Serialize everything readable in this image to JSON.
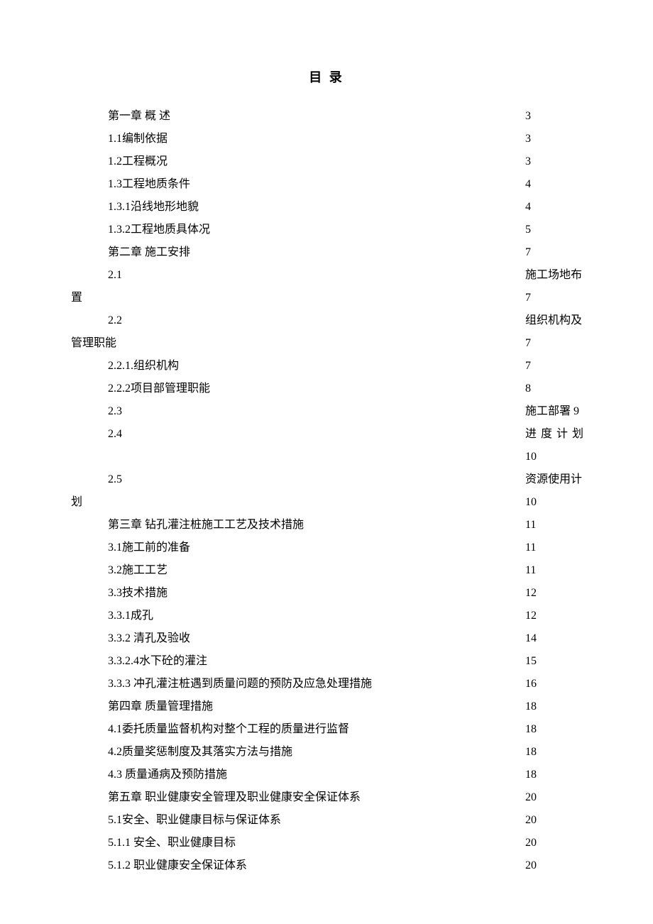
{
  "title": "目 录",
  "toc": [
    {
      "left": "第一章 概 述",
      "right": "3"
    },
    {
      "left": "1.1编制依据",
      "right": "3"
    },
    {
      "left": "1.2工程概况",
      "right": "3"
    },
    {
      "left": "1.3工程地质条件",
      "right": "4"
    },
    {
      "left": "1.3.1沿线地形地貌",
      "right": "4"
    },
    {
      "left": "1.3.2工程地质具体况",
      "right": "5"
    },
    {
      "left": "第二章 施工安排",
      "right": "7"
    },
    {
      "type": "wrap2",
      "left": "2.1",
      "right_label": "施工场地布",
      "cont_left": "置",
      "cont_right": "7"
    },
    {
      "type": "wrap2",
      "left": "2.2",
      "right_label": "组织机构及",
      "cont_left": "管理职能",
      "cont_right": "7"
    },
    {
      "left": "2.2.1.组织机构",
      "right": "7"
    },
    {
      "left": "2.2.2项目部管理职能",
      "right": "8"
    },
    {
      "type": "inline",
      "left": "2.3",
      "right_full": "施工部署 9"
    },
    {
      "type": "wrap2s",
      "left": "2.4",
      "right_label": "进度计划",
      "cont_left": "",
      "cont_right": "10"
    },
    {
      "type": "wrap2",
      "left": "2.5",
      "right_label": "资源使用计",
      "cont_left": "划",
      "cont_right": "10"
    },
    {
      "left": "第三章 钻孔灌注桩施工工艺及技术措施",
      "right": "11"
    },
    {
      "left": "3.1施工前的准备",
      "right": "11"
    },
    {
      "left": "3.2施工工艺",
      "right": "11"
    },
    {
      "left": "3.3技术措施",
      "right": "12"
    },
    {
      "left": "3.3.1成孔",
      "right": "12"
    },
    {
      "left": "3.3.2 清孔及验收",
      "right": "14"
    },
    {
      "left": "3.3.2.4水下砼的灌注",
      "right": "15"
    },
    {
      "left": "3.3.3 冲孔灌注桩遇到质量问题的预防及应急处理措施",
      "right": "16"
    },
    {
      "left": "第四章 质量管理措施",
      "right": "18"
    },
    {
      "left": "4.1委托质量监督机构对整个工程的质量进行监督",
      "right": "18"
    },
    {
      "left": "4.2质量奖惩制度及其落实方法与措施",
      "right": "18"
    },
    {
      "left": "4.3 质量通病及预防措施",
      "right": "18"
    },
    {
      "left": "第五章 职业健康安全管理及职业健康安全保证体系",
      "right": "20"
    },
    {
      "left": "5.1安全、职业健康目标与保证体系",
      "right": "20"
    },
    {
      "left": "5.1.1 安全、职业健康目标",
      "right": "20"
    },
    {
      "left": "5.1.2 职业健康安全保证体系",
      "right": "20"
    }
  ]
}
